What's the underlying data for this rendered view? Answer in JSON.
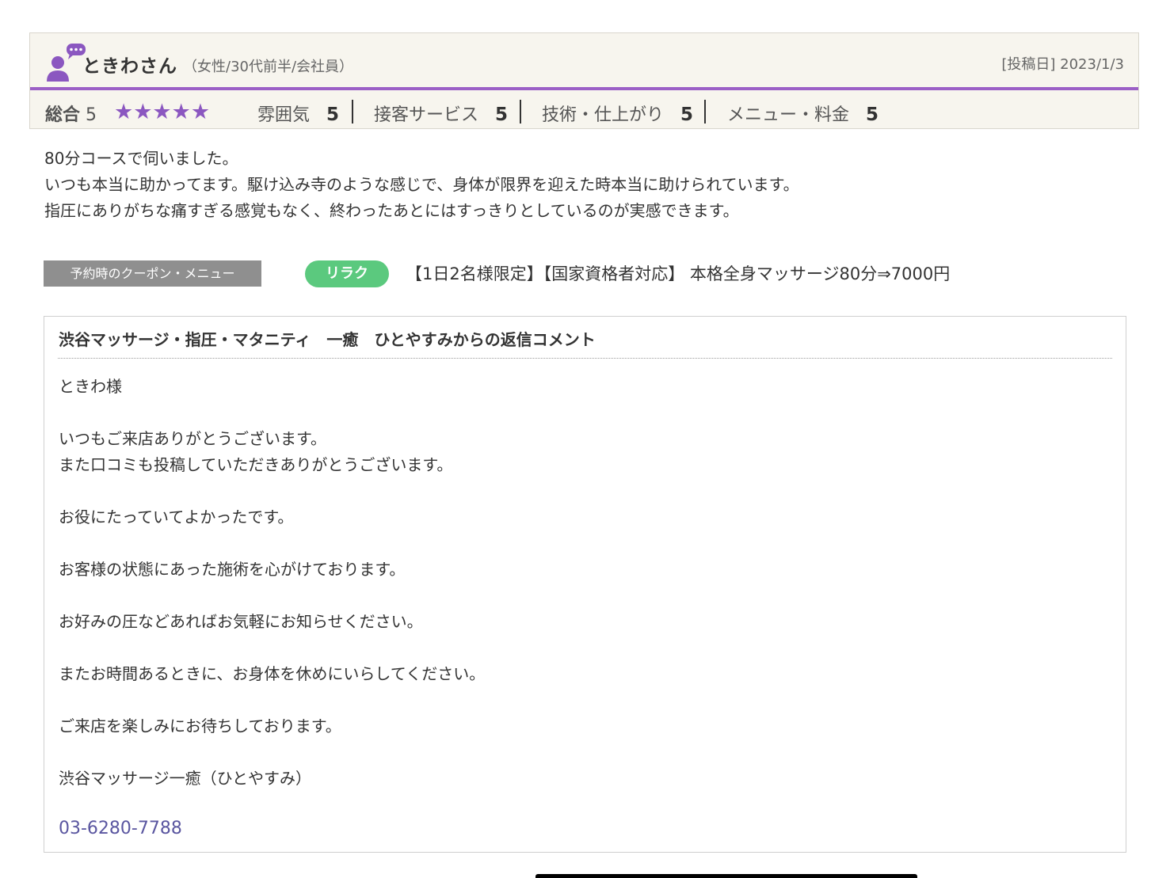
{
  "reviewer": {
    "name": "ときわさん",
    "meta": "（女性/30代前半/会社員）",
    "post_date": "[投稿日] 2023/1/3"
  },
  "ratings": {
    "overall_label": "総合",
    "overall_value": "5",
    "stars": "★★★★★",
    "star_count": 5,
    "star_color": "#8b57c0",
    "items": [
      {
        "label": "雰囲気",
        "value": "5"
      },
      {
        "label": "接客サービス",
        "value": "5"
      },
      {
        "label": "技術・仕上がり",
        "value": "5"
      },
      {
        "label": "メニュー・料金",
        "value": "5"
      }
    ]
  },
  "review": {
    "lines": [
      "80分コースで伺いました。",
      "いつも本当に助かってます。駆け込み寺のような感じで、身体が限界を迎えた時本当に助けられています。",
      "指圧にありがちな痛すぎる感覚もなく、終わったあとにはすっきりとしているのが実感できます。"
    ]
  },
  "coupon": {
    "label": "予約時のクーポン・メニュー",
    "badge": "リラク",
    "badge_color": "#5bc97e",
    "text": "【1日2名様限定】【国家資格者対応】 本格全身マッサージ80分⇒7000円"
  },
  "reply": {
    "title": "渋谷マッサージ・指圧・マタニティ　一癒　ひとやすみからの返信コメント",
    "paragraphs": [
      [
        "ときわ様"
      ],
      [
        "いつもご来店ありがとうございます。",
        "また口コミも投稿していただきありがとうございます。"
      ],
      [
        "お役にたっていてよかったです。"
      ],
      [
        "お客様の状態にあった施術を心がけております。"
      ],
      [
        "お好みの圧などあればお気軽にお知らせください。"
      ],
      [
        "またお時間あるときに、お身体を休めにいらしてください。"
      ],
      [
        "ご来店を楽しみにお待ちしております。"
      ],
      [
        "渋谷マッサージ一癒（ひとやすみ）"
      ]
    ],
    "phone": "03-6280-7788"
  },
  "colors": {
    "accent_purple": "#9b5fc6",
    "phone_link": "#5a56a0"
  }
}
